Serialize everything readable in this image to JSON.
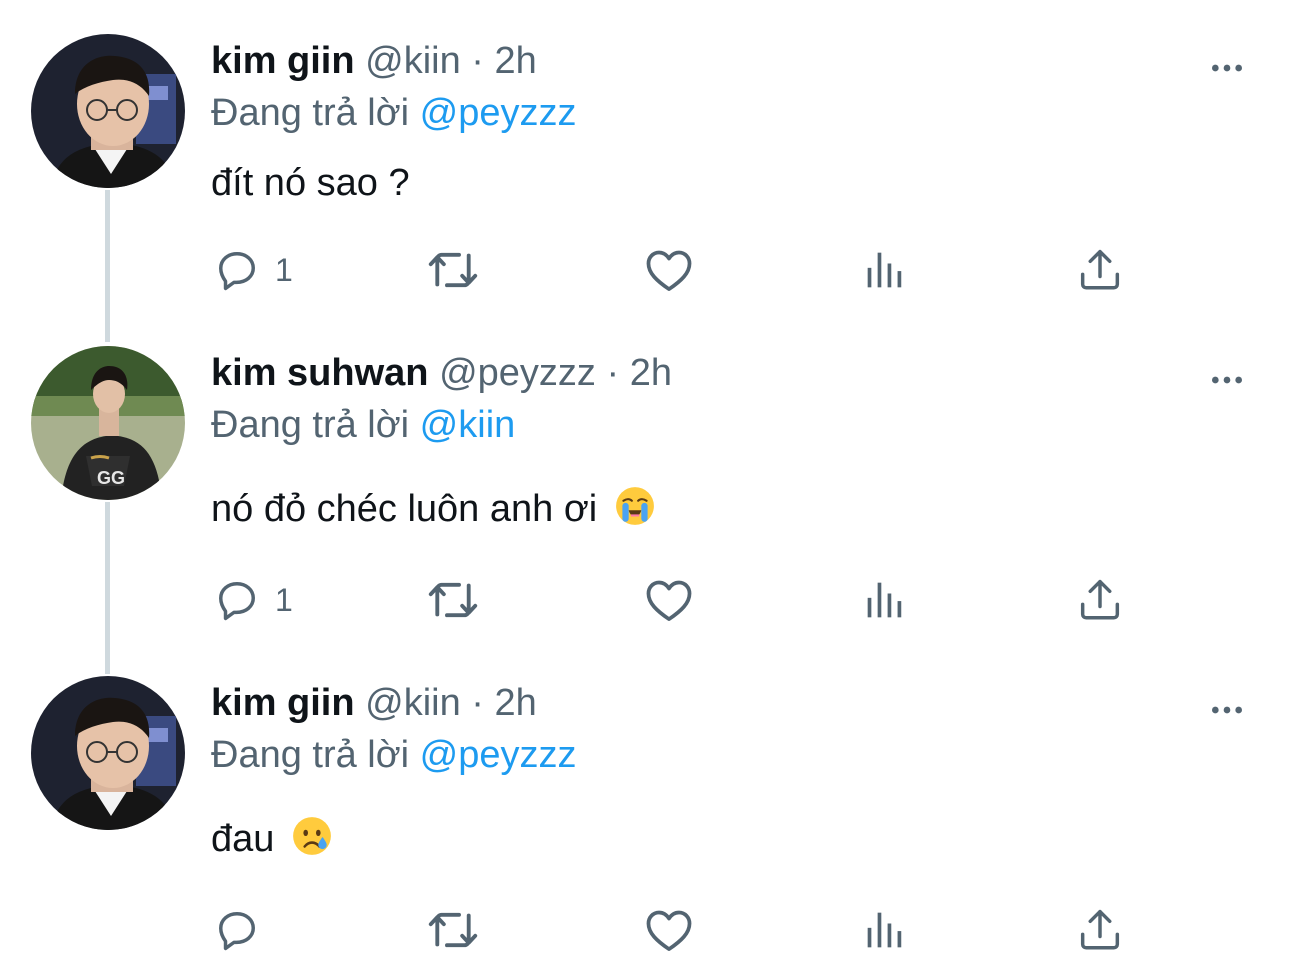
{
  "colors": {
    "text": "#0f1419",
    "secondary": "#536471",
    "mention": "#1d9bf0",
    "thread_line": "#cfd9de"
  },
  "icons": {
    "reply": "speech-bubble-icon",
    "retweet": "retweet-icon",
    "like": "heart-icon",
    "views": "bar-chart-icon",
    "share": "share-upload-icon",
    "more": "more-horizontal-icon"
  },
  "tweets": [
    {
      "name": "kim giin",
      "handle": "@kiin",
      "separator": "·",
      "time": "2h",
      "replying_prefix": "Đang trả lời",
      "replying_to": "@peyzzz",
      "text": "đít nó sao ?",
      "emoji": "",
      "reply_count": "1"
    },
    {
      "name": "kim suhwan",
      "handle": "@peyzzz",
      "separator": "·",
      "time": "2h",
      "replying_prefix": "Đang trả lời",
      "replying_to": "@kiin",
      "text": "nó đỏ chéc luôn anh ơi",
      "emoji": "loudly-crying-face",
      "reply_count": "1"
    },
    {
      "name": "kim giin",
      "handle": "@kiin",
      "separator": "·",
      "time": "2h",
      "replying_prefix": "Đang trả lời",
      "replying_to": "@peyzzz",
      "text": "đau",
      "emoji": "crying-face",
      "reply_count": ""
    }
  ]
}
